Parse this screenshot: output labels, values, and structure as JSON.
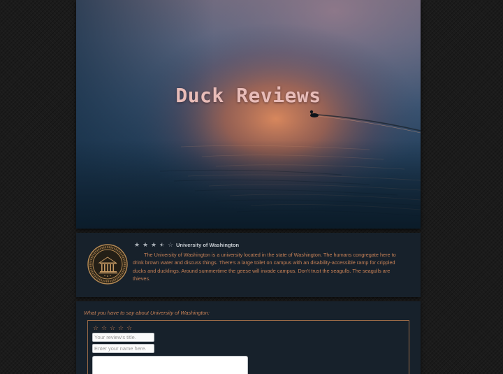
{
  "header": {
    "title": "Duck Reviews"
  },
  "review": {
    "logo_icon": "university-seal-icon",
    "rating": 3.5,
    "rating_max": 5,
    "stars": [
      "star-full-icon",
      "star-full-icon",
      "star-full-icon",
      "star-half-icon",
      "star-empty-icon"
    ],
    "name": "University of Washington",
    "text": "The University of Washington is a university located in the state of Washington. The humans congregate here to drink brown water and discuss things. There's a large toilet on campus with an disability-accessible ramp for crippled ducks and ducklings. Around summertime the geese will invade campus. Don't trust the seagulls. The seagulls are thieves."
  },
  "form": {
    "prompt": "What you have to say about University of Washington:",
    "rating_icon": "star-empty-icon",
    "rating_count": 5,
    "title_placeholder": "Your review's title.",
    "name_placeholder": "Enter your name here.",
    "body_placeholder": ""
  },
  "colors": {
    "page_background": "#1b1b1b",
    "card_background": "#17212b",
    "accent_text": "#c88257",
    "hero_title": "#e8bcb8"
  }
}
